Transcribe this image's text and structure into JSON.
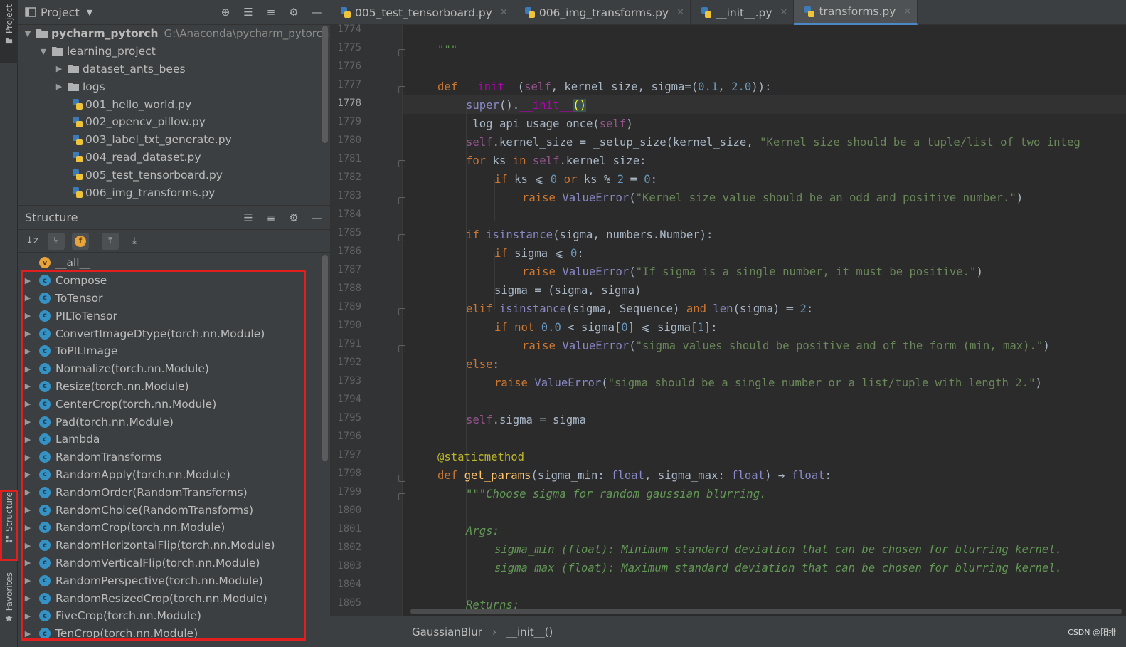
{
  "strip": {
    "project": "Project",
    "structure": "Structure",
    "favorites": "Favorites"
  },
  "project_panel": {
    "title": "Project",
    "root": {
      "name": "pycharm_pytorch",
      "path": "G:\\Anaconda\\pycharm_pytorch"
    },
    "folder": "learning_project",
    "subfolders": [
      "dataset_ants_bees",
      "logs"
    ],
    "files": [
      "001_hello_world.py",
      "002_opencv_pillow.py",
      "003_label_txt_generate.py",
      "004_read_dataset.py",
      "005_test_tensorboard.py",
      "006_img_transforms.py"
    ]
  },
  "structure_panel": {
    "title": "Structure",
    "variable": "__all__",
    "variable_badge": "v",
    "class_badge": "c",
    "classes": [
      "Compose",
      "ToTensor",
      "PILToTensor",
      "ConvertImageDtype(torch.nn.Module)",
      "ToPILImage",
      "Normalize(torch.nn.Module)",
      "Resize(torch.nn.Module)",
      "CenterCrop(torch.nn.Module)",
      "Pad(torch.nn.Module)",
      "Lambda",
      "RandomTransforms",
      "RandomApply(torch.nn.Module)",
      "RandomOrder(RandomTransforms)",
      "RandomChoice(RandomTransforms)",
      "RandomCrop(torch.nn.Module)",
      "RandomHorizontalFlip(torch.nn.Module)",
      "RandomVerticalFlip(torch.nn.Module)",
      "RandomPerspective(torch.nn.Module)",
      "RandomResizedCrop(torch.nn.Module)",
      "FiveCrop(torch.nn.Module)",
      "TenCrop(torch.nn.Module)"
    ]
  },
  "tabs": [
    {
      "label": "005_test_tensorboard.py",
      "active": false
    },
    {
      "label": "006_img_transforms.py",
      "active": false
    },
    {
      "label": "__init__.py",
      "active": false
    },
    {
      "label": "transforms.py",
      "active": true
    }
  ],
  "editor": {
    "current_line": "1778",
    "line_numbers": [
      "1774",
      "1775",
      "1776",
      "1777",
      "1778",
      "1779",
      "1780",
      "1781",
      "1782",
      "1783",
      "1784",
      "1785",
      "1786",
      "1787",
      "1788",
      "1789",
      "1790",
      "1791",
      "1792",
      "1793",
      "1794",
      "1795",
      "1796",
      "1797",
      "1798",
      "1799",
      "1800",
      "1801",
      "1802",
      "1803",
      "1804",
      "1805"
    ],
    "code": {
      "l1775": "\"\"\"",
      "l1777_name": "__init__",
      "l1777_self": "self",
      "l1777_rest": ", kernel_size, sigma=(",
      "l1777_n1": "0.1",
      "l1777_n2": "2.0",
      "l1778_a": "super().",
      "l1778_b": "__init__",
      "l1779": "_log_api_usage_once(",
      "l1780_a": ".kernel_size = _setup_size(kernel_size, ",
      "l1780_str": "\"Kernel size should be a tuple/list of two integ",
      "l1781": ".kernel_size:",
      "l1783_str": "\"Kernel size value should be an odd and positive number.\"",
      "l1787_str": "\"If sigma is a single number, it must be positive.\"",
      "l1788": "sigma = (sigma, sigma)",
      "l1791_str": "\"sigma values should be positive and of the form (min, max).\"",
      "l1793_str": "\"sigma should be a single number or a list/tuple with length 2.\"",
      "l1795": ".sigma = sigma",
      "l1797": "@staticmethod",
      "l1799": "\"\"\"Choose sigma for random gaussian blurring.",
      "l1801": "Args:",
      "l1802": "sigma_min (float): Minimum standard deviation that can be chosen for blurring kernel.",
      "l1803": "sigma_max (float): Maximum standard deviation that can be chosen for blurring kernel.",
      "l1805": "Returns:"
    }
  },
  "breadcrumb": [
    "GaussianBlur",
    "__init__()"
  ],
  "watermark": "CSDN @阳排"
}
